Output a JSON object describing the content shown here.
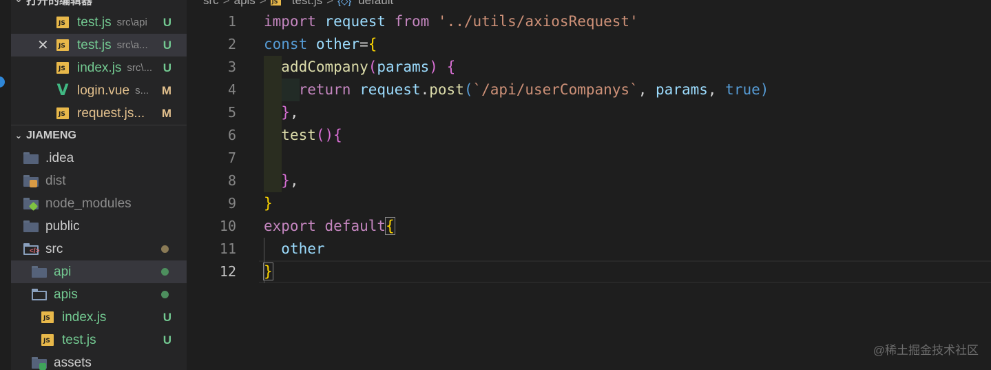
{
  "open_editors": {
    "header": "打开的编辑器",
    "items": [
      {
        "name": "test.js",
        "desc": "src\\api",
        "badge": "U"
      },
      {
        "name": "test.js",
        "desc": "src\\a...",
        "badge": "U"
      },
      {
        "name": "index.js",
        "desc": "src\\...",
        "badge": "U"
      },
      {
        "name": "login.vue",
        "desc": "s...",
        "badge": "M"
      },
      {
        "name": "request.js...",
        "desc": "",
        "badge": "M"
      }
    ]
  },
  "explorer": {
    "project": "JIAMENG",
    "items": [
      {
        "name": ".idea"
      },
      {
        "name": "dist"
      },
      {
        "name": "node_modules"
      },
      {
        "name": "public"
      },
      {
        "name": "src"
      },
      {
        "name": "api"
      },
      {
        "name": "apis"
      },
      {
        "name": "index.js",
        "badge": "U"
      },
      {
        "name": "test.js",
        "badge": "U"
      },
      {
        "name": "assets"
      }
    ]
  },
  "breadcrumb": {
    "parts": [
      "src",
      "apis",
      "test.js",
      "default"
    ],
    "separator": ">"
  },
  "editor": {
    "line_numbers": [
      "1",
      "2",
      "3",
      "4",
      "5",
      "6",
      "7",
      "8",
      "9",
      "10",
      "11",
      "12"
    ],
    "active_line": "12",
    "lines": [
      [
        [
          "kw",
          "import"
        ],
        [
          "pl",
          " "
        ],
        [
          "var",
          "request"
        ],
        [
          "pl",
          " "
        ],
        [
          "kw",
          "from"
        ],
        [
          "pl",
          " "
        ],
        [
          "str",
          "'../utils/axiosRequest'"
        ]
      ],
      [
        [
          "st",
          "const"
        ],
        [
          "pl",
          " "
        ],
        [
          "var",
          "other"
        ],
        [
          "pl",
          "="
        ],
        [
          "br",
          "{"
        ]
      ],
      [
        [
          "pl",
          "  "
        ],
        [
          "fn",
          "addCompany"
        ],
        [
          "br2",
          "("
        ],
        [
          "var",
          "params"
        ],
        [
          "br2",
          ")"
        ],
        [
          "pl",
          " "
        ],
        [
          "br2",
          "{"
        ]
      ],
      [
        [
          "pl",
          "    "
        ],
        [
          "kw",
          "return"
        ],
        [
          "pl",
          " "
        ],
        [
          "var",
          "request"
        ],
        [
          "pl",
          "."
        ],
        [
          "fn",
          "post"
        ],
        [
          "st",
          "("
        ],
        [
          "str",
          "`/api/userCompanys`"
        ],
        [
          "pl",
          ", "
        ],
        [
          "var",
          "params"
        ],
        [
          "pl",
          ", "
        ],
        [
          "st",
          "true"
        ],
        [
          "st",
          ")"
        ]
      ],
      [
        [
          "pl",
          "  "
        ],
        [
          "br2",
          "}"
        ],
        [
          "pl",
          ","
        ]
      ],
      [
        [
          "pl",
          "  "
        ],
        [
          "fn",
          "test"
        ],
        [
          "br2",
          "()"
        ],
        [
          "br2",
          "{"
        ]
      ],
      [],
      [
        [
          "pl",
          "  "
        ],
        [
          "br2",
          "}"
        ],
        [
          "pl",
          ","
        ]
      ],
      [
        [
          "br",
          "}"
        ]
      ],
      [
        [
          "kw",
          "export"
        ],
        [
          "pl",
          " "
        ],
        [
          "kw",
          "default"
        ],
        [
          "br",
          "{"
        ]
      ],
      [
        [
          "pl",
          "  "
        ],
        [
          "var",
          "other"
        ]
      ],
      [
        [
          "br",
          "}"
        ]
      ]
    ]
  },
  "watermark": "@稀土掘金技术社区",
  "colors": {
    "untracked": "#73c991",
    "modified": "#e2c08d",
    "keyword": "#c586c0",
    "storage": "#569cd6",
    "variable": "#9cdcfe",
    "function": "#dcdcaa",
    "string": "#ce9178"
  }
}
